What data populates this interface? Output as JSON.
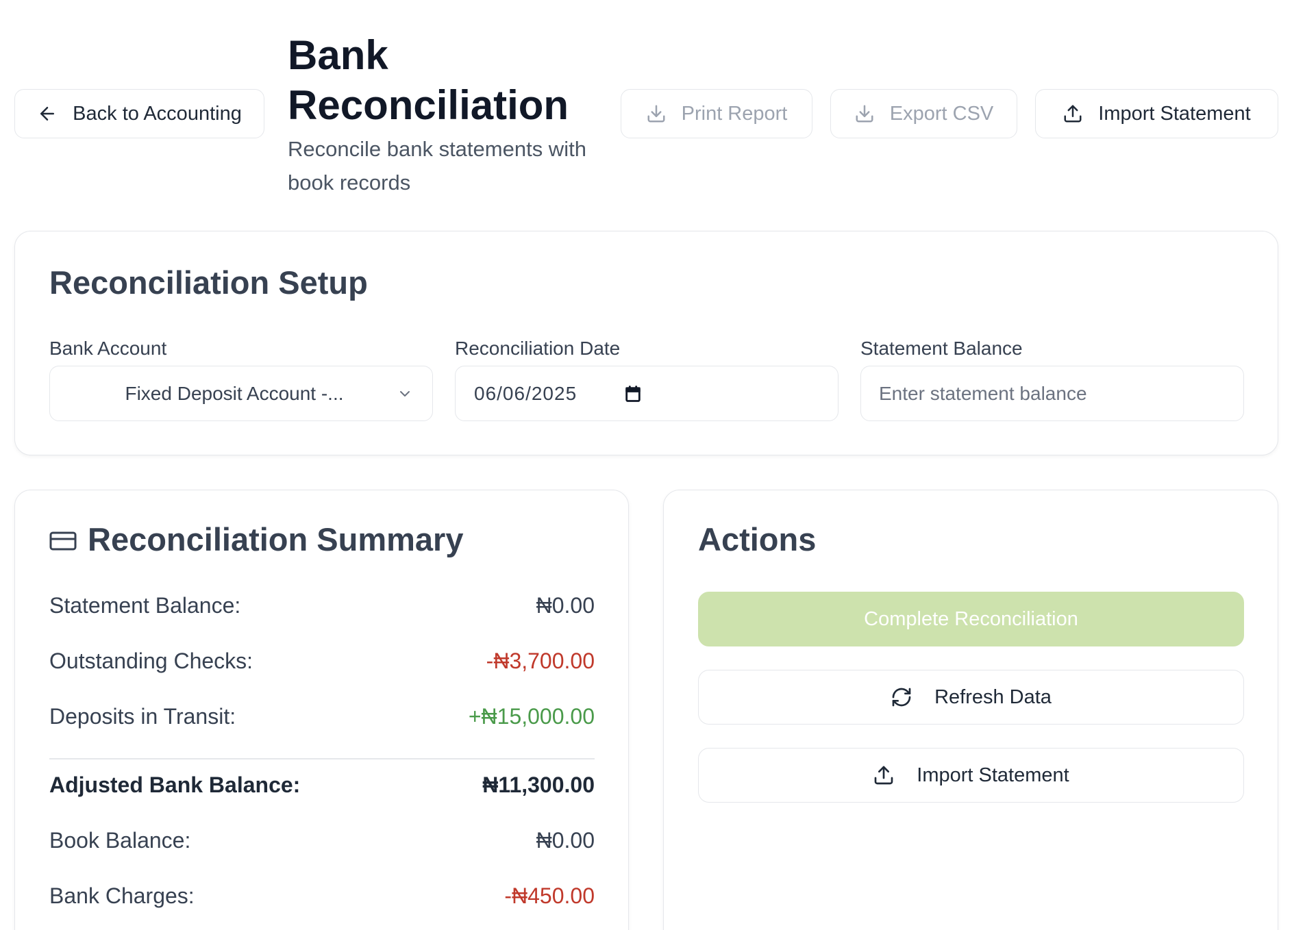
{
  "header": {
    "back_label": "Back to Accounting",
    "title": "Bank Reconciliation",
    "subtitle": "Reconcile bank statements with book records",
    "print_label": "Print Report",
    "export_label": "Export CSV",
    "import_label": "Import Statement"
  },
  "setup": {
    "title": "Reconciliation Setup",
    "account_label": "Bank Account",
    "account_value": "Fixed Deposit Account -...",
    "date_label": "Reconciliation Date",
    "date_value": "06/06/2025",
    "balance_label": "Statement Balance",
    "balance_placeholder": "Enter statement balance"
  },
  "summary": {
    "title": "Reconciliation Summary",
    "rows": [
      {
        "label": "Statement Balance:",
        "value": "₦0.00"
      },
      {
        "label": "Outstanding Checks:",
        "value": "-₦3,700.00"
      },
      {
        "label": "Deposits in Transit:",
        "value": "+₦15,000.00"
      },
      {
        "label": "Adjusted Bank Balance:",
        "value": "₦11,300.00"
      },
      {
        "label": "Book Balance:",
        "value": "₦0.00"
      },
      {
        "label": "Bank Charges:",
        "value": "-₦450.00"
      }
    ]
  },
  "actions": {
    "title": "Actions",
    "complete_label": "Complete Reconciliation",
    "refresh_label": "Refresh Data",
    "import_label": "Import Statement"
  },
  "colors": {
    "negative": "#c0392b",
    "positive": "#4a9a4a",
    "complete_button_bg": "#cde2ad"
  }
}
